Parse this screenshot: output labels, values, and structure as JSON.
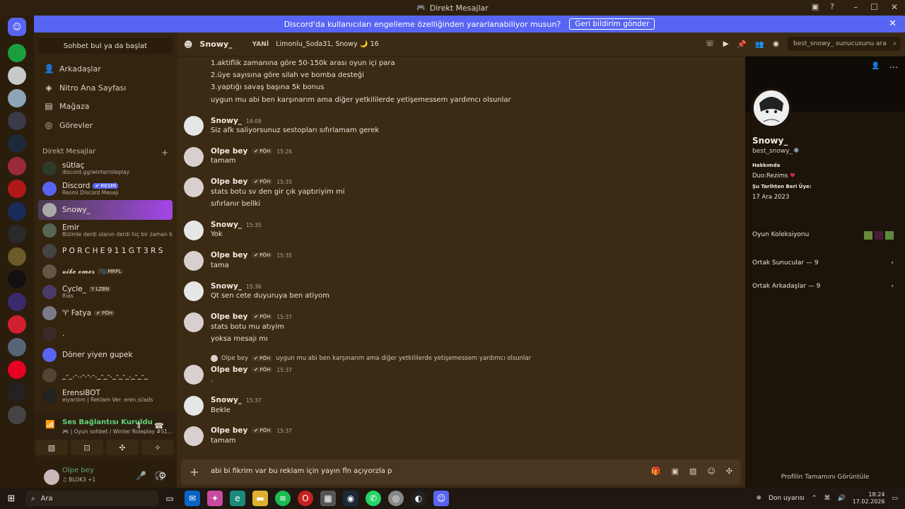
{
  "window": {
    "title": "Direkt Mesajlar"
  },
  "banner": {
    "text": "Discord'da kullanıcıları engelleme özelliğinden yararlanabiliyor musun?",
    "button": "Geri bildirim gönder",
    "accent": "#5865f2"
  },
  "sidebar": {
    "search_placeholder": "Sohbet bul ya da başlat",
    "nav": [
      {
        "label": "Arkadaşlar",
        "icon": "friends-icon"
      },
      {
        "label": "Nitro Ana Sayfası",
        "icon": "nitro-icon"
      },
      {
        "label": "Mağaza",
        "icon": "shop-icon"
      },
      {
        "label": "Görevler",
        "icon": "quests-icon"
      }
    ],
    "dm_header": "Direkt Mesajlar",
    "dm_add": "+",
    "dms": [
      {
        "name": "sütlaç",
        "sub": "discord.gg/winterroleplay",
        "color": "#2e3a2a"
      },
      {
        "name": "Discord",
        "tag": "✔ RESMİ",
        "sub": "Resmi Discord Mesajı",
        "color": "#5865f2"
      },
      {
        "name": "Snowy_",
        "sub": "",
        "color": "#777"
      },
      {
        "name": "Emir",
        "sub": "Bizimle derdi olanın derdi hiç bir zaman bitmez...",
        "color": "#556655"
      },
      {
        "name": "P O R C H E 9 1 1 G T 3 R S",
        "sub": "",
        "color": "#444"
      },
      {
        "name": "𝓿𝓲𝓫𝓮 𝓸𝓶𝓮𝓻",
        "tag": "🐾 MRPL",
        "sub": "",
        "color": "#665544"
      },
      {
        "name": "Cycle_",
        "tag": "Y LZBN",
        "sub": "Rias",
        "color": "#4a3a6a"
      },
      {
        "name": "♈ Fatya",
        "tag": "✔ PÖH",
        "sub": "",
        "color": "#7a7a88"
      },
      {
        "name": ".",
        "sub": "",
        "color": "#3a2a2a"
      },
      {
        "name": "Döner yiyen gupek",
        "sub": "",
        "color": "#5865f2"
      },
      {
        "name": "_-_.-..-.-.-._-_-._-_-_._-_-_",
        "sub": "",
        "color": "#554433"
      },
      {
        "name": "ErensiBOT",
        "sub": "eiyardım | Reklam Ver: eren.si/ads",
        "color": "#222"
      }
    ],
    "voice": {
      "status": "Ses Bağlantısı Kuruldu",
      "channel": "🎮 | Oyun sohbet / Winter Roleplay #S1..."
    },
    "user": {
      "name": "Olpe bey",
      "status": "♫ BLOK3 +1"
    }
  },
  "chat": {
    "title": "Snowy_",
    "badge": "YANİ",
    "members": "Limonlu_Soda31, Snowy 🌙 16",
    "search_placeholder": "best_snowy_ sunucusunu ara",
    "top_lines": [
      "1.aktiflik zamanına göre 50-150k arası oyun içi para",
      "2.üye sayısına göre silah ve bomba desteği",
      "3.yaptığı savaş başına 5k bonus",
      "uygun mu abi ben karşınarım ama diğer yetkililerde yetişemessem yardımcı olsunlar"
    ],
    "messages": [
      {
        "author": "Snowy_",
        "tag": "",
        "time": "14:09",
        "lines": [
          "Siz afk saliyorsunuz sestopları sıfırlamam gerek"
        ]
      },
      {
        "author": "Olpe bey",
        "tag": "✔ PÖH",
        "time": "15:26",
        "lines": [
          "tamam"
        ]
      },
      {
        "author": "Olpe bey",
        "tag": "✔ PÖH",
        "time": "15:35",
        "lines": [
          "stats botu sv den gir çık yaptıriyim mi",
          "sıfırlanır bellki"
        ]
      },
      {
        "author": "Snowy_",
        "tag": "",
        "time": "15:35",
        "lines": [
          "Yok"
        ]
      },
      {
        "author": "Olpe bey",
        "tag": "✔ PÖH",
        "time": "15:35",
        "lines": [
          "tama"
        ]
      },
      {
        "author": "Snowy_",
        "tag": "",
        "time": "15:36",
        "lines": [
          "Qt sen cete duyuruya ben atiyom"
        ]
      },
      {
        "author": "Olpe bey",
        "tag": "✔ PÖH",
        "time": "15:37",
        "lines": [
          "stats botu mu atıyim",
          "yoksa mesajı mı"
        ]
      },
      {
        "author": "Olpe bey",
        "tag": "✔ PÖH",
        "time": "15:37",
        "lines": [
          "."
        ]
      },
      {
        "author": "Snowy_",
        "tag": "",
        "time": "15:37",
        "lines": [
          "Bekle"
        ]
      },
      {
        "author": "Olpe bey",
        "tag": "✔ PÖH",
        "time": "15:37",
        "lines": [
          "tamam"
        ]
      }
    ],
    "reply": {
      "author": "Olpe bey",
      "tag": "✔ PÖH",
      "text": "uygun mu abi ben karşınarım ama diğer yetkililerde yetişemessem yardımcı olsunlar"
    },
    "composer_text": "abi bi fikrim var bu reklam için yayın fln açıyorzla p"
  },
  "profile": {
    "display_name": "Snowy_",
    "username": "best_snowy_",
    "about_label": "Hakkımda",
    "about_text": "Duo:Rezims",
    "member_since_label": "Şu Tarihten Beri Üye:",
    "member_since": "17 Ara 2023",
    "game_collection": "Oyun Koleksiyonu",
    "mutual_servers": "Ortak Sunucular — 9",
    "mutual_friends": "Ortak Arkadaşlar — 9",
    "footer": "Profilin Tamamını Görüntüle"
  },
  "taskbar": {
    "search": "Ara",
    "weather": "Don uyarısı",
    "time": "18:24",
    "date": "17.02.2026"
  }
}
